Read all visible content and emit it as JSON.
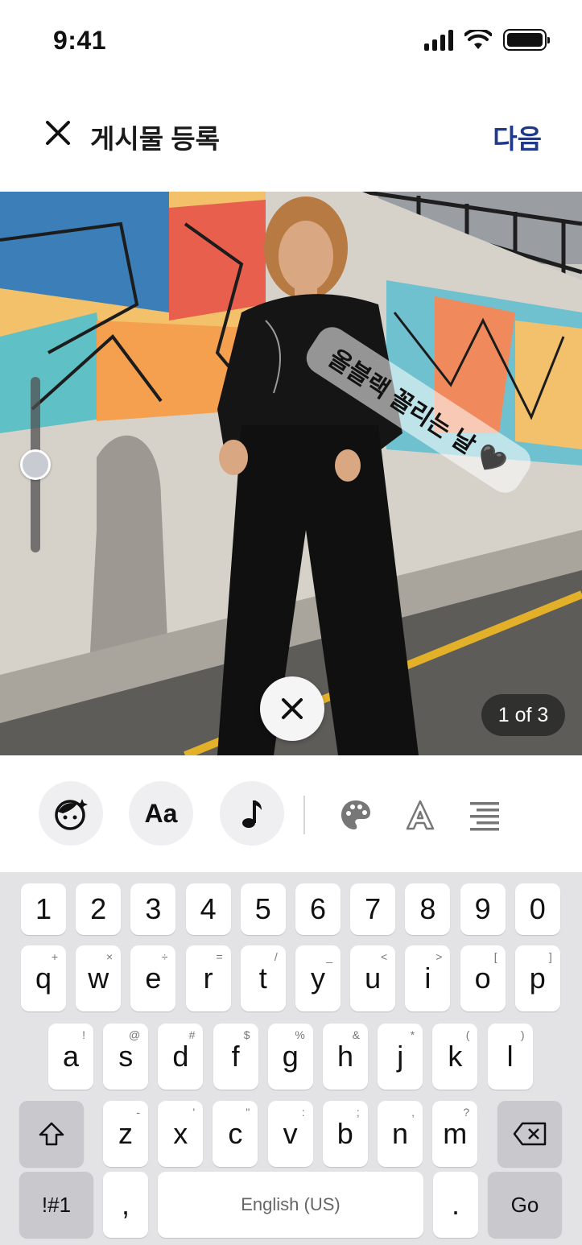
{
  "status_bar": {
    "time": "9:41"
  },
  "header": {
    "title": "게시물 등록",
    "next_label": "다음"
  },
  "photo": {
    "sticker_text": "올블랙 꼴리는 날 🖤",
    "page_indicator": "1 of 3"
  },
  "toolbar": {
    "text_label": "Aa",
    "icons": [
      "face-sticker-icon",
      "text-icon",
      "music-icon",
      "palette-icon",
      "text-outline-icon",
      "align-right-icon"
    ]
  },
  "keyboard": {
    "number_row": [
      "1",
      "2",
      "3",
      "4",
      "5",
      "6",
      "7",
      "8",
      "9",
      "0"
    ],
    "row1": [
      "q",
      "w",
      "e",
      "r",
      "t",
      "y",
      "u",
      "i",
      "o",
      "p"
    ],
    "row1_sub": [
      "+",
      "×",
      "÷",
      "=",
      "/",
      "_",
      "<",
      ">",
      "[",
      "]"
    ],
    "row2": [
      "a",
      "s",
      "d",
      "f",
      "g",
      "h",
      "j",
      "k",
      "l"
    ],
    "row2_sub": [
      "!",
      "@",
      "#",
      "$",
      "%",
      "&",
      "*",
      "(",
      ")"
    ],
    "row3": [
      "z",
      "x",
      "c",
      "v",
      "b",
      "n",
      "m"
    ],
    "row3_sub": [
      "-",
      "'",
      "\"",
      ":",
      ";",
      ",",
      "?"
    ],
    "symbols_label": "!#1",
    "comma_label": ",",
    "space_label": "English (US)",
    "period_label": ".",
    "go_label": "Go"
  },
  "colors": {
    "accent": "#1f3a8a",
    "keyboard_bg": "#e3e3e6",
    "key_bg": "#ffffff"
  }
}
